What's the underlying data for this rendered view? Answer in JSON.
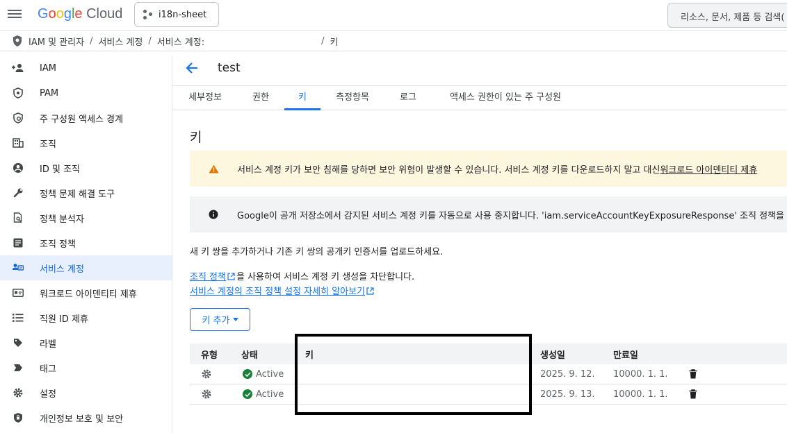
{
  "topbar": {
    "logo_letters": [
      "G",
      "o",
      "o",
      "g",
      "l",
      "e"
    ],
    "logo_product": "Cloud",
    "project_name": "i18n-sheet",
    "search_placeholder": "리소스, 문서, 제품 등 검색("
  },
  "breadcrumb": {
    "items": [
      "IAM 및 관리자",
      "서비스 계정",
      "서비스 계정:",
      "키"
    ],
    "separator": "/"
  },
  "sidebar": {
    "items": [
      {
        "label": "IAM",
        "icon": "person-add-icon"
      },
      {
        "label": "PAM",
        "icon": "shield-badge-icon"
      },
      {
        "label": "주 구성원 액세스 경계",
        "icon": "policy-icon"
      },
      {
        "label": "조직",
        "icon": "building-icon"
      },
      {
        "label": "ID 및 조직",
        "icon": "account-circle-icon"
      },
      {
        "label": "정책 문제 해결 도구",
        "icon": "wrench-icon"
      },
      {
        "label": "정책 분석자",
        "icon": "document-search-icon"
      },
      {
        "label": "조직 정책",
        "icon": "list-document-icon"
      },
      {
        "label": "서비스 계정",
        "icon": "service-account-icon",
        "active": true
      },
      {
        "label": "워크로드 아이덴티티 제휴",
        "icon": "id-card-icon"
      },
      {
        "label": "직원 ID 제휴",
        "icon": "list-icon"
      },
      {
        "label": "라벨",
        "icon": "label-icon"
      },
      {
        "label": "태그",
        "icon": "tag-icon"
      },
      {
        "label": "설정",
        "icon": "gear-icon"
      },
      {
        "label": "개인정보 보호 및 보안",
        "icon": "privacy-shield-icon"
      }
    ]
  },
  "main": {
    "title": "test",
    "tabs": [
      "세부정보",
      "권한",
      "키",
      "측정항목",
      "로그",
      "액세스 권한이 있는 주 구성원"
    ],
    "active_tab": "키",
    "section_title": "키",
    "warning": {
      "text": "서비스 계정 키가 보안 침해를 당하면 보안 위험이 발생할 수 있습니다. 서비스 계정 키를 다운로드하지 말고 대신 ",
      "link": "워크로드 아이덴티티 제휴"
    },
    "info": {
      "text": "Google이 공개 저장소에서 감지된 서비스 계정 키를 자동으로 사용 중지합니다. 'iam.serviceAccountKeyExposureResponse' 조직 정책을"
    },
    "description": "새 키 쌍을 추가하거나 기존 키 쌍의 공개키 인증서를 업로드하세요.",
    "policy_link": "조직 정책",
    "policy_text": "을 사용하여 서비스 계정 키 생성을 차단합니다.",
    "learn_more_link": "서비스 계정의 조직 정책 설정 자세히 알아보기",
    "add_key_label": "키 추가"
  },
  "table": {
    "columns": [
      "유형",
      "상태",
      "키",
      "생성일",
      "만료일"
    ],
    "rows": [
      {
        "status": "Active",
        "key": "",
        "created": "2025. 9. 12.",
        "expires": "10000. 1. 1."
      },
      {
        "status": "Active",
        "key": "",
        "created": "2025. 9. 13.",
        "expires": "10000. 1. 1."
      }
    ]
  },
  "colors": {
    "accent": "#1a73e8",
    "active_bg": "#e8f0fe",
    "warning_bg": "#fef7e0",
    "warning_icon": "#e37400",
    "success": "#188038"
  }
}
